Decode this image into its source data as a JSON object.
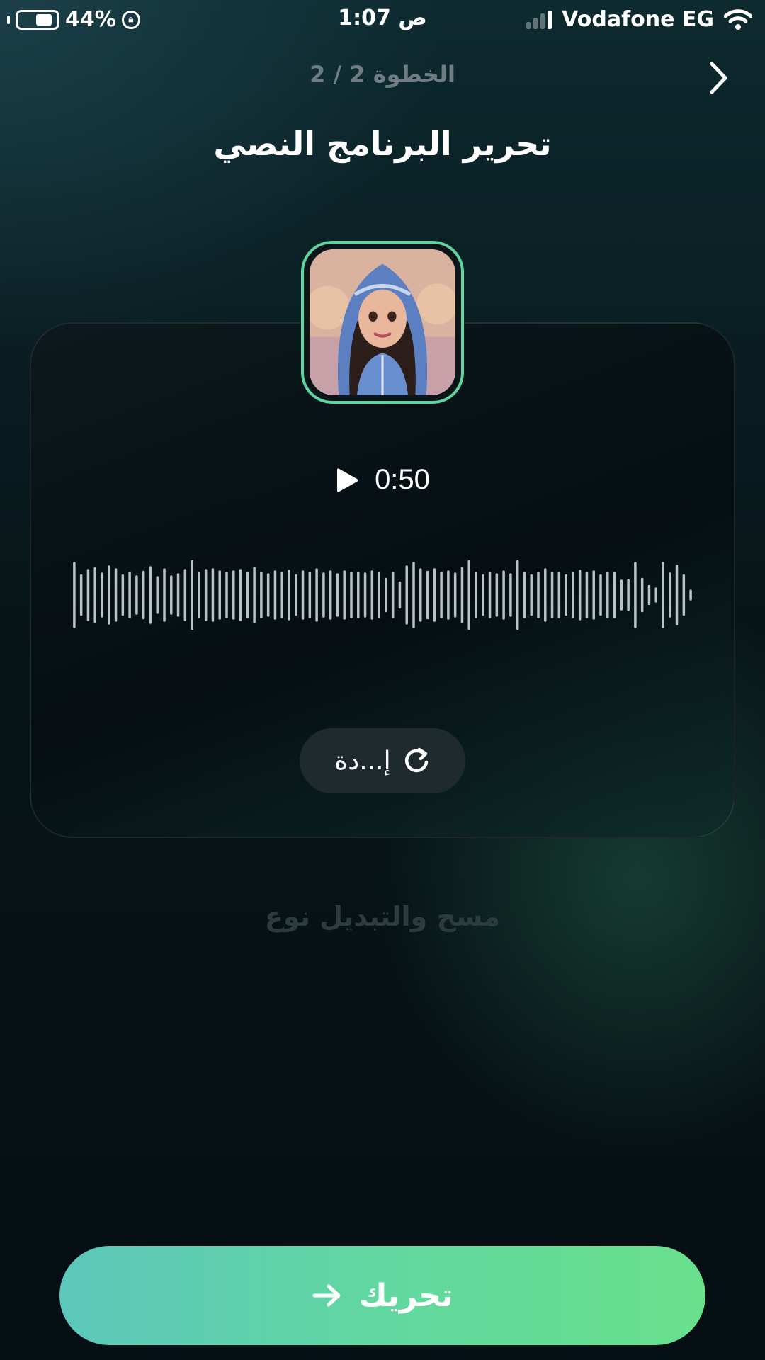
{
  "status_bar": {
    "battery": "44%",
    "time": "1:07 ص",
    "carrier": "Vodafone EG"
  },
  "header": {
    "step": "الخطوة 2 / 2",
    "title": "تحرير البرنامج النصي",
    "back_icon": "chevron-right-icon"
  },
  "player": {
    "duration": "0:50",
    "play_icon": "play-icon",
    "waveform_heights": [
      0.9,
      0.55,
      0.7,
      0.75,
      0.6,
      0.8,
      0.72,
      0.55,
      0.62,
      0.52,
      0.65,
      0.78,
      0.5,
      0.72,
      0.52,
      0.58,
      0.7,
      0.95,
      0.62,
      0.7,
      0.72,
      0.66,
      0.62,
      0.66,
      0.7,
      0.62,
      0.76,
      0.62,
      0.58,
      0.66,
      0.62,
      0.68,
      0.55,
      0.66,
      0.62,
      0.72,
      0.6,
      0.66,
      0.58,
      0.66,
      0.62,
      0.62,
      0.6,
      0.66,
      0.62,
      0.45,
      0.62,
      0.35,
      0.8,
      0.9,
      0.72,
      0.65,
      0.72,
      0.62,
      0.66,
      0.6,
      0.75,
      0.95,
      0.62,
      0.55,
      0.62,
      0.58,
      0.66,
      0.58,
      0.95,
      0.62,
      0.55,
      0.62,
      0.72,
      0.62,
      0.62,
      0.55,
      0.62,
      0.68,
      0.62,
      0.66,
      0.55,
      0.62,
      0.62,
      0.4,
      0.42,
      0.9,
      0.45,
      0.25,
      0.18,
      0.9,
      0.6,
      0.82,
      0.55,
      0.12
    ],
    "waveform_color": "#b9c3c6"
  },
  "retry": {
    "label": "إ...دة",
    "icon": "reload-icon"
  },
  "clear_switch": "مسح والتبديل نوع",
  "cta": {
    "label": "تحريك",
    "icon": "arrow-right-icon"
  },
  "colors": {
    "accent": "#5fd4a0",
    "cta_start": "#5cc7bb",
    "cta_end": "#68e08c"
  }
}
